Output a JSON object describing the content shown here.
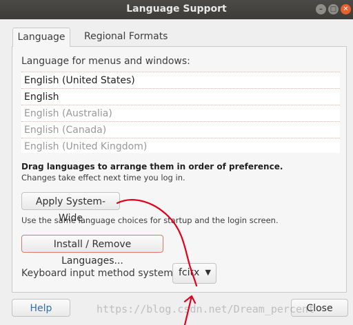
{
  "window": {
    "title": "Language Support"
  },
  "tabs": [
    {
      "label": "Language",
      "active": true
    },
    {
      "label": "Regional Formats",
      "active": false
    }
  ],
  "language": {
    "list_label": "Language for menus and windows:",
    "items": [
      {
        "label": "English (United States)",
        "dim": false
      },
      {
        "label": "English",
        "dim": false
      },
      {
        "label": "English (Australia)",
        "dim": true
      },
      {
        "label": "English (Canada)",
        "dim": true
      },
      {
        "label": "English (United Kingdom)",
        "dim": true
      }
    ],
    "drag_hint": "Drag languages to arrange them in order of preference.",
    "effect_hint": "Changes take effect next time you log in.",
    "apply_label": "Apply System-Wide",
    "apply_desc": "Use the same language choices for startup and the login screen.",
    "install_label": "Install / Remove Languages...",
    "keyboard_label": "Keyboard input method system:",
    "keyboard_value": "fcitx"
  },
  "footer": {
    "help_label": "Help",
    "close_label": "Close"
  },
  "watermark": "https://blog.csdn.net/Dream_percent",
  "colors": {
    "titlebar": "#3d3c38",
    "close_button": "#e9602c",
    "annotation": "#e3001b",
    "help_text": "#2e6fb5"
  }
}
